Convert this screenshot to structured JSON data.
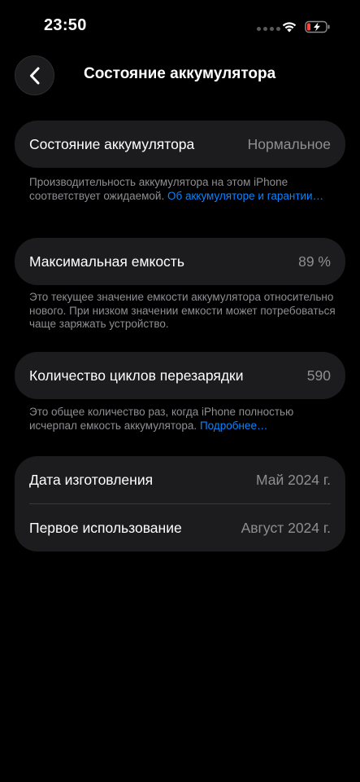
{
  "status_bar": {
    "time": "23:50"
  },
  "header": {
    "title": "Состояние аккумулятора"
  },
  "battery_health": {
    "label": "Состояние аккумулятора",
    "value": "Нормальное",
    "footnote": "Производительность аккумулятора на этом iPhone соответствует ожидаемой.",
    "footnote_link": "Об аккумуляторе и гарантии…"
  },
  "max_capacity": {
    "label": "Максимальная емкость",
    "value": "89 %",
    "footnote": "Это текущее значение емкости аккумулятора относительно нового. При низком значении емкости может потребоваться чаще заряжать устройство."
  },
  "cycle_count": {
    "label": "Количество циклов перезарядки",
    "value": "590",
    "footnote": "Это общее количество раз, когда iPhone полностью исчерпал емкость аккумулятора.",
    "footnote_link": "Подробнее…"
  },
  "dates": {
    "manufacture_label": "Дата изготовления",
    "manufacture_value": "Май 2024 г.",
    "first_use_label": "Первое использование",
    "first_use_value": "Август 2024 г."
  },
  "colors": {
    "background": "#000000",
    "card": "#1c1c1e",
    "secondary_text": "#8e8e93",
    "link": "#0a84ff",
    "battery_low": "#ff453a"
  },
  "icons": {
    "back": "chevron-left-icon",
    "wifi": "wifi-icon",
    "battery": "battery-charging-icon"
  }
}
